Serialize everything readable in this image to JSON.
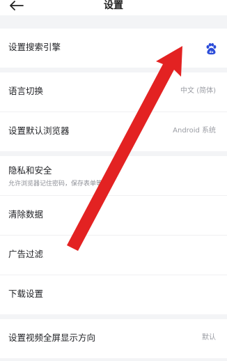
{
  "header": {
    "title": "设置"
  },
  "sections": {
    "search": {
      "label": "设置搜索引擎",
      "engine_icon": "baidu-paw-icon"
    },
    "basic": [
      {
        "label": "语言切换",
        "value": "中文 (简体)"
      },
      {
        "label": "设置默认浏览器",
        "value": "Android 系统"
      }
    ],
    "privacy": {
      "title": "隐私和安全",
      "subtitle": "允许浏览器记住密码，保存表单等",
      "items": [
        "清除数据",
        "广告过滤",
        "下载设置"
      ]
    },
    "video": {
      "label": "设置视频全屏显示方向",
      "value": "默认"
    }
  },
  "colors": {
    "accent_icon": "#2b4cd9",
    "annotation_arrow": "#e32222"
  }
}
